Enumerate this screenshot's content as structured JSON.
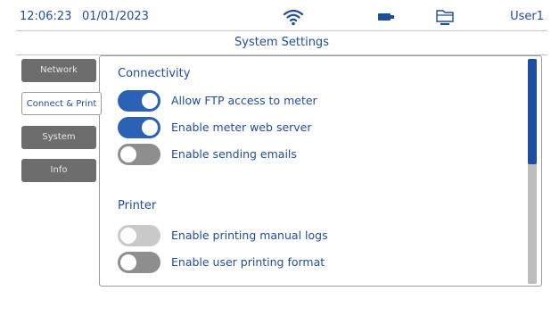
{
  "status": {
    "time": "12:06:23",
    "date": "01/01/2023",
    "user": "User1",
    "icons": [
      "wifi-icon",
      "battery-icon",
      "storage-icon"
    ]
  },
  "header": {
    "title": "System Settings"
  },
  "sidebar": {
    "tabs": [
      {
        "label": "Network",
        "active": false
      },
      {
        "label": "Connect & Print",
        "active": true
      },
      {
        "label": "System",
        "active": false
      },
      {
        "label": "Info",
        "active": false
      }
    ]
  },
  "connectivity": {
    "title": "Connectivity",
    "options": [
      {
        "label": "Allow FTP access to meter",
        "enabled": true
      },
      {
        "label": "Enable meter web server",
        "enabled": true
      },
      {
        "label": "Enable sending emails",
        "enabled": false
      }
    ]
  },
  "printer": {
    "title": "Printer",
    "options": [
      {
        "label": "Enable printing manual logs",
        "enabled": false
      },
      {
        "label": "Enable user printing format",
        "enabled": false
      }
    ]
  },
  "colors": {
    "accent": "#1f4e99",
    "toggle_on": "#2b62b6",
    "toggle_off": "#8e8e8e",
    "tab_inactive": "#6d6d6d"
  }
}
